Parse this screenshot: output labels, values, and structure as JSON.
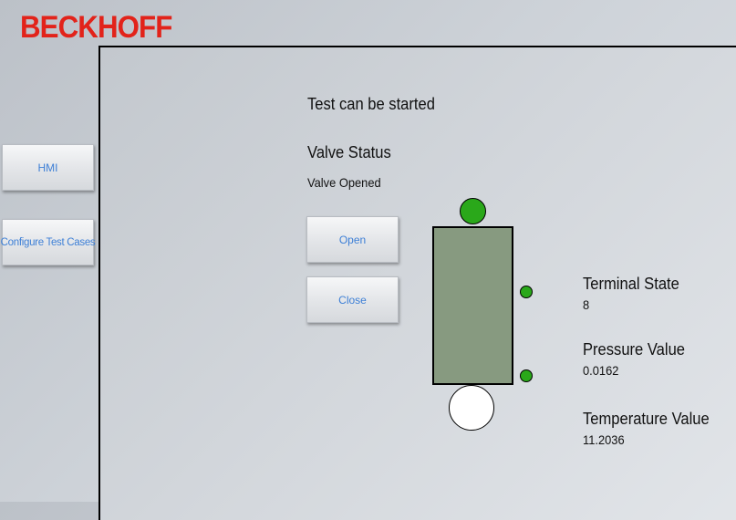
{
  "brand": {
    "logo_text": "BECKHOFF",
    "color": "#e2231a"
  },
  "nav": {
    "hmi_label": "HMI",
    "configure_label": "Configure Test Cases"
  },
  "main": {
    "test_status": "Test can be started",
    "valve_status_heading": "Valve Status",
    "valve_status_value": "Valve Opened",
    "open_label": "Open",
    "close_label": "Close"
  },
  "readouts": {
    "terminal_state_label": "Terminal State",
    "terminal_state_value": "8",
    "pressure_label": "Pressure Value",
    "pressure_value": "0.0162",
    "temperature_label": "Temperature Value",
    "temperature_value": "11.2036"
  },
  "valve": {
    "body_color": "#879a80",
    "top_indicator": "on",
    "bottom_indicator": "off",
    "side_upper_indicator": "on",
    "side_lower_indicator": "on",
    "on_color": "#2aa81a",
    "off_color": "#ffffff"
  }
}
